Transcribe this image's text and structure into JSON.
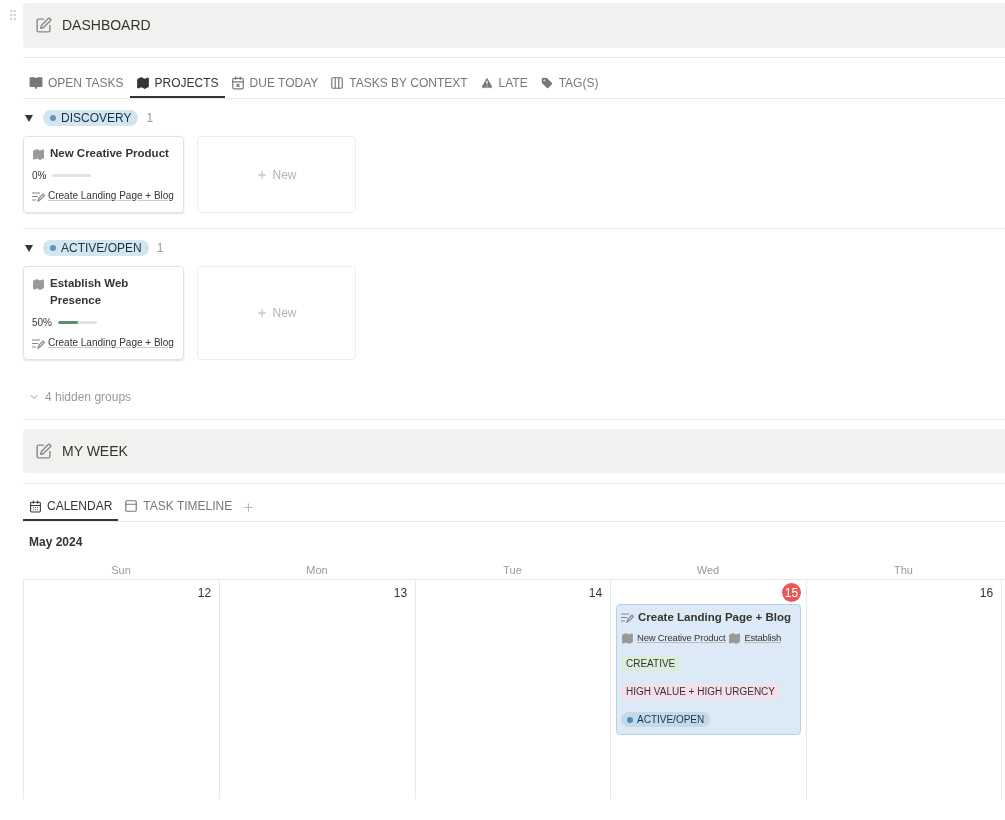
{
  "dashboard": {
    "title": "DASHBOARD"
  },
  "tabs": [
    {
      "label": "OPEN TASKS",
      "kind": "book",
      "selected": false
    },
    {
      "label": "PROJECTS",
      "kind": "map",
      "selected": true
    },
    {
      "label": "DUE TODAY",
      "kind": "calendar",
      "selected": false
    },
    {
      "label": "TASKS BY CONTEXT",
      "kind": "columns",
      "selected": false
    },
    {
      "label": "LATE",
      "kind": "warning",
      "selected": false
    },
    {
      "label": "TAG(S)",
      "kind": "tag",
      "selected": false
    }
  ],
  "groups": [
    {
      "label": "DISCOVERY",
      "count": "1",
      "expanded": true,
      "cards": [
        {
          "title": "New Creative Product",
          "percent": "0%",
          "level": 0,
          "task": "Create Landing Page + Blog"
        }
      ],
      "new_label": "New"
    },
    {
      "label": "ACTIVE/OPEN",
      "count": "1",
      "expanded": true,
      "cards": [
        {
          "title": "Establish Web Presence",
          "percent": "50%",
          "level": 0.5,
          "task": "Create Landing Page + Blog"
        }
      ],
      "new_label": "New"
    }
  ],
  "hidden_groups": "4 hidden groups",
  "my_week": {
    "title": "MY WEEK"
  },
  "calendar_tabs": [
    {
      "label": "CALENDAR",
      "kind": "calendar",
      "selected": true
    },
    {
      "label": "TASK TIMELINE",
      "kind": "timeline",
      "selected": false
    }
  ],
  "calendar": {
    "month": "May 2024",
    "weekdays": [
      "Sun",
      "Mon",
      "Tue",
      "Wed",
      "Thu"
    ],
    "days": [
      {
        "number": "12",
        "today": false
      },
      {
        "number": "13",
        "today": false
      },
      {
        "number": "14",
        "today": false
      },
      {
        "number": "15",
        "today": true,
        "events": [
          {
            "title": "Create Landing Page + Blog",
            "projects": [
              "New Creative Product",
              "Establish"
            ],
            "tags": [
              {
                "label": "CREATIVE",
                "color": "#dbeddb"
              },
              {
                "label": "HIGH VALUE + HIGH URGENCY",
                "color": "#f4dfeb"
              }
            ],
            "status": "ACTIVE/OPEN"
          }
        ]
      },
      {
        "number": "16",
        "today": false
      }
    ]
  }
}
